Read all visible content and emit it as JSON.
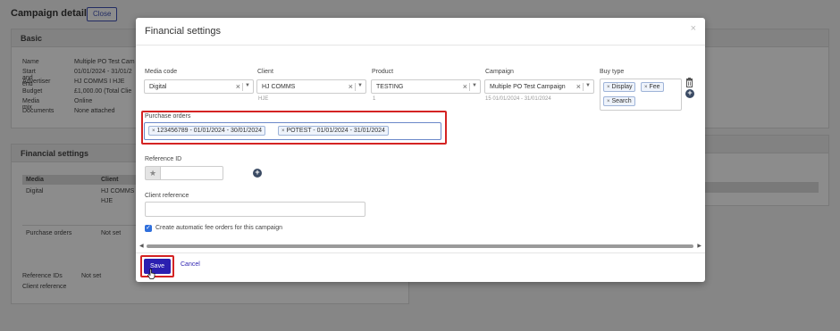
{
  "background": {
    "title": "Campaign details",
    "close_label": "Close",
    "basic": {
      "heading": "Basic",
      "rows": [
        {
          "key": "Name",
          "value": "Multiple PO Test Cam"
        },
        {
          "key": "Start and end",
          "value": "01/01/2024 - 31/01/2"
        },
        {
          "key": "Advertiser",
          "value": "HJ COMMS I HJE"
        },
        {
          "key": "Budget",
          "value": "£1,000.00 (Total Clie"
        },
        {
          "key": "Media mix",
          "value": "Online"
        },
        {
          "key": "Documents",
          "value": "None attached"
        }
      ]
    },
    "financial": {
      "heading": "Financial settings",
      "col_media": "Media",
      "col_client": "Client",
      "media_value": "Digital",
      "client_value_1": "HJ COMMS",
      "client_value_2": "HJE",
      "po_label": "Purchase orders",
      "po_value": "Not set",
      "ref_ids_label": "Reference IDs",
      "ref_ids_value": "Not set",
      "client_ref_label": "Client reference"
    }
  },
  "modal": {
    "title": "Financial settings",
    "close_icon": "×",
    "fields": {
      "media_code": {
        "label": "Media code",
        "value": "Digital"
      },
      "client": {
        "label": "Client",
        "value": "HJ COMMS",
        "sub": "HJE"
      },
      "product": {
        "label": "Product",
        "value": "TESTING",
        "sub": "1"
      },
      "campaign": {
        "label": "Campaign",
        "value": "Multiple PO Test Campaign",
        "sub": "15 01/01/2024 - 31/01/2024"
      },
      "buy_type": {
        "label": "Buy type",
        "chips": [
          "Display",
          "Fee",
          "Search"
        ]
      }
    },
    "purchase_orders": {
      "label": "Purchase orders",
      "chips": [
        "123456789 - 01/01/2024 - 30/01/2024",
        "POTEST - 01/01/2024 - 31/01/2024"
      ]
    },
    "reference_id": {
      "label": "Reference ID"
    },
    "client_reference": {
      "label": "Client reference"
    },
    "auto_fee": {
      "label": "Create automatic fee orders for this campaign",
      "checked": true
    },
    "save_label": "Save",
    "cancel_label": "Cancel"
  },
  "icons": {
    "clear": "×",
    "caret": "▼",
    "star": "★",
    "plus": "+",
    "trash": "trash-icon",
    "check": "✓",
    "arrow_left": "◀",
    "arrow_right": "▶",
    "cursor": "pointer-cursor-icon"
  },
  "colors": {
    "primary": "#2b1fb0",
    "highlight": "#d42323",
    "chip_border": "#9fb4d8"
  }
}
